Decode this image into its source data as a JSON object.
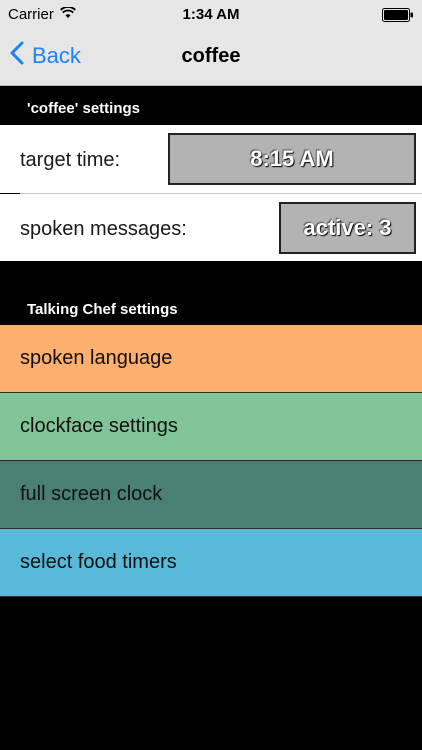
{
  "status_bar": {
    "carrier": "Carrier",
    "time": "1:34 AM"
  },
  "nav": {
    "back_label": "Back",
    "title": "coffee"
  },
  "item_settings": {
    "header": "'coffee' settings",
    "rows": [
      {
        "label": "target time:",
        "value": "8:15 AM"
      },
      {
        "label": "spoken messages:",
        "value": "active: 3"
      }
    ]
  },
  "app_settings": {
    "header": "Talking Chef settings",
    "items": [
      {
        "label": "spoken language",
        "color": "#fcaf6f"
      },
      {
        "label": "clockface settings",
        "color": "#80c497"
      },
      {
        "label": "full screen clock",
        "color": "#4a7f76"
      },
      {
        "label": "select food timers",
        "color": "#58b9d8"
      }
    ]
  },
  "colors": {
    "accent": "#1a82fb",
    "background": "#000000",
    "nav_background": "#e6e6e6"
  }
}
